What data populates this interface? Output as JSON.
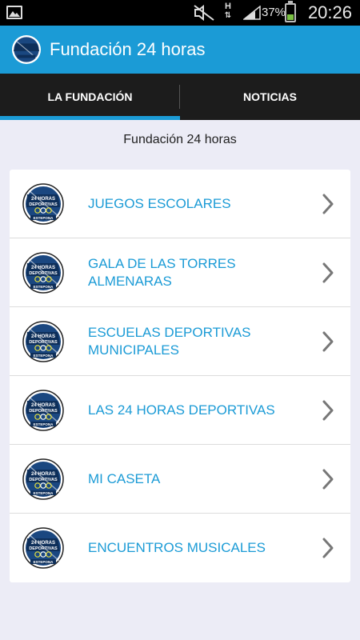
{
  "status_bar": {
    "battery_percent": "37%",
    "battery_level": 0.37,
    "time": "20:26",
    "network_label": "H",
    "icons": [
      "gallery-icon",
      "mute-icon",
      "hplus-icon",
      "signal-icon",
      "battery-icon"
    ]
  },
  "action_bar": {
    "title": "Fundación 24 horas",
    "color": "#1B9BD6"
  },
  "tabs": [
    {
      "label": "LA FUNDACIÓN",
      "selected": true
    },
    {
      "label": "NOTICIAS",
      "selected": false
    }
  ],
  "section_title": "Fundación 24 horas",
  "logo_text": {
    "line1": "24 HORAS",
    "line2": "DEPORTIVAS",
    "line3": "ESTEPONA"
  },
  "items": [
    {
      "label": "JUEGOS ESCOLARES"
    },
    {
      "label": "GALA DE LAS TORRES ALMENARAS"
    },
    {
      "label": "ESCUELAS DEPORTIVAS MUNICIPALES"
    },
    {
      "label": "LAS 24 HORAS DEPORTIVAS"
    },
    {
      "label": "MI CASETA"
    },
    {
      "label": "ENCUENTROS MUSICALES"
    }
  ]
}
